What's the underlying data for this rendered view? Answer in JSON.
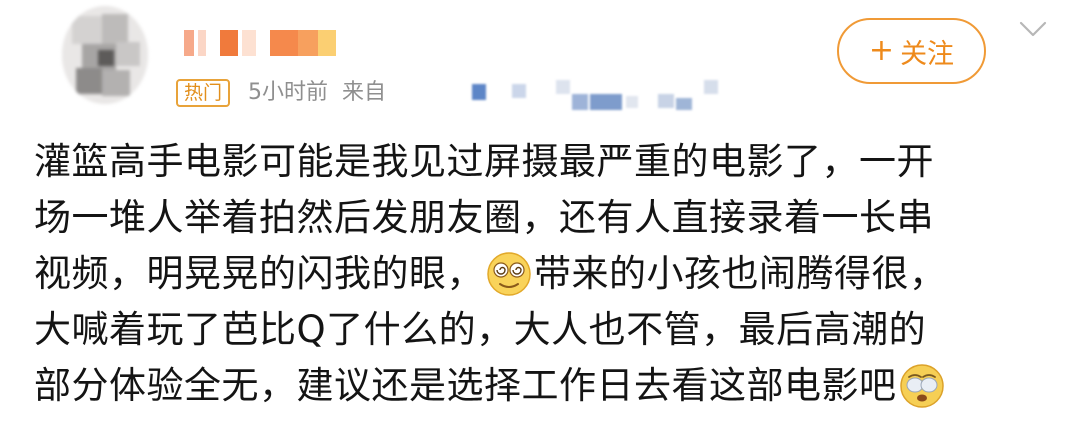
{
  "post": {
    "author": {
      "avatar": "avatar-image",
      "name": ""
    },
    "badge": "热门",
    "time": "5小时前",
    "source_prefix": "来自",
    "follow": {
      "icon": "plus-icon",
      "label": "关注"
    },
    "menu_icon": "chevron-down-icon",
    "lines": [
      {
        "text": "灌篮高手电影可能是我见过屏摄最严重的电影了，一开"
      },
      {
        "text": "场一堆人举着拍然后发朋友圈，还有人直接录着一长串"
      },
      {
        "text_before": "视频，明晃晃的闪我的眼，",
        "emoji": "dizzy-face-emoji",
        "text_after": "带来的小孩也闹腾得很，"
      },
      {
        "text": "大喊着玩了芭比Q了什么的，大人也不管，最后高潮的"
      },
      {
        "text_before": "部分体验全无，建议还是选择工作日去看这部电影吧",
        "emoji": "exhausted-face-emoji",
        "text_after": ""
      }
    ]
  },
  "colors": {
    "accent_orange": "#ee8a1b",
    "meta_gray": "#8f8f8f",
    "body_text": "#141414"
  }
}
